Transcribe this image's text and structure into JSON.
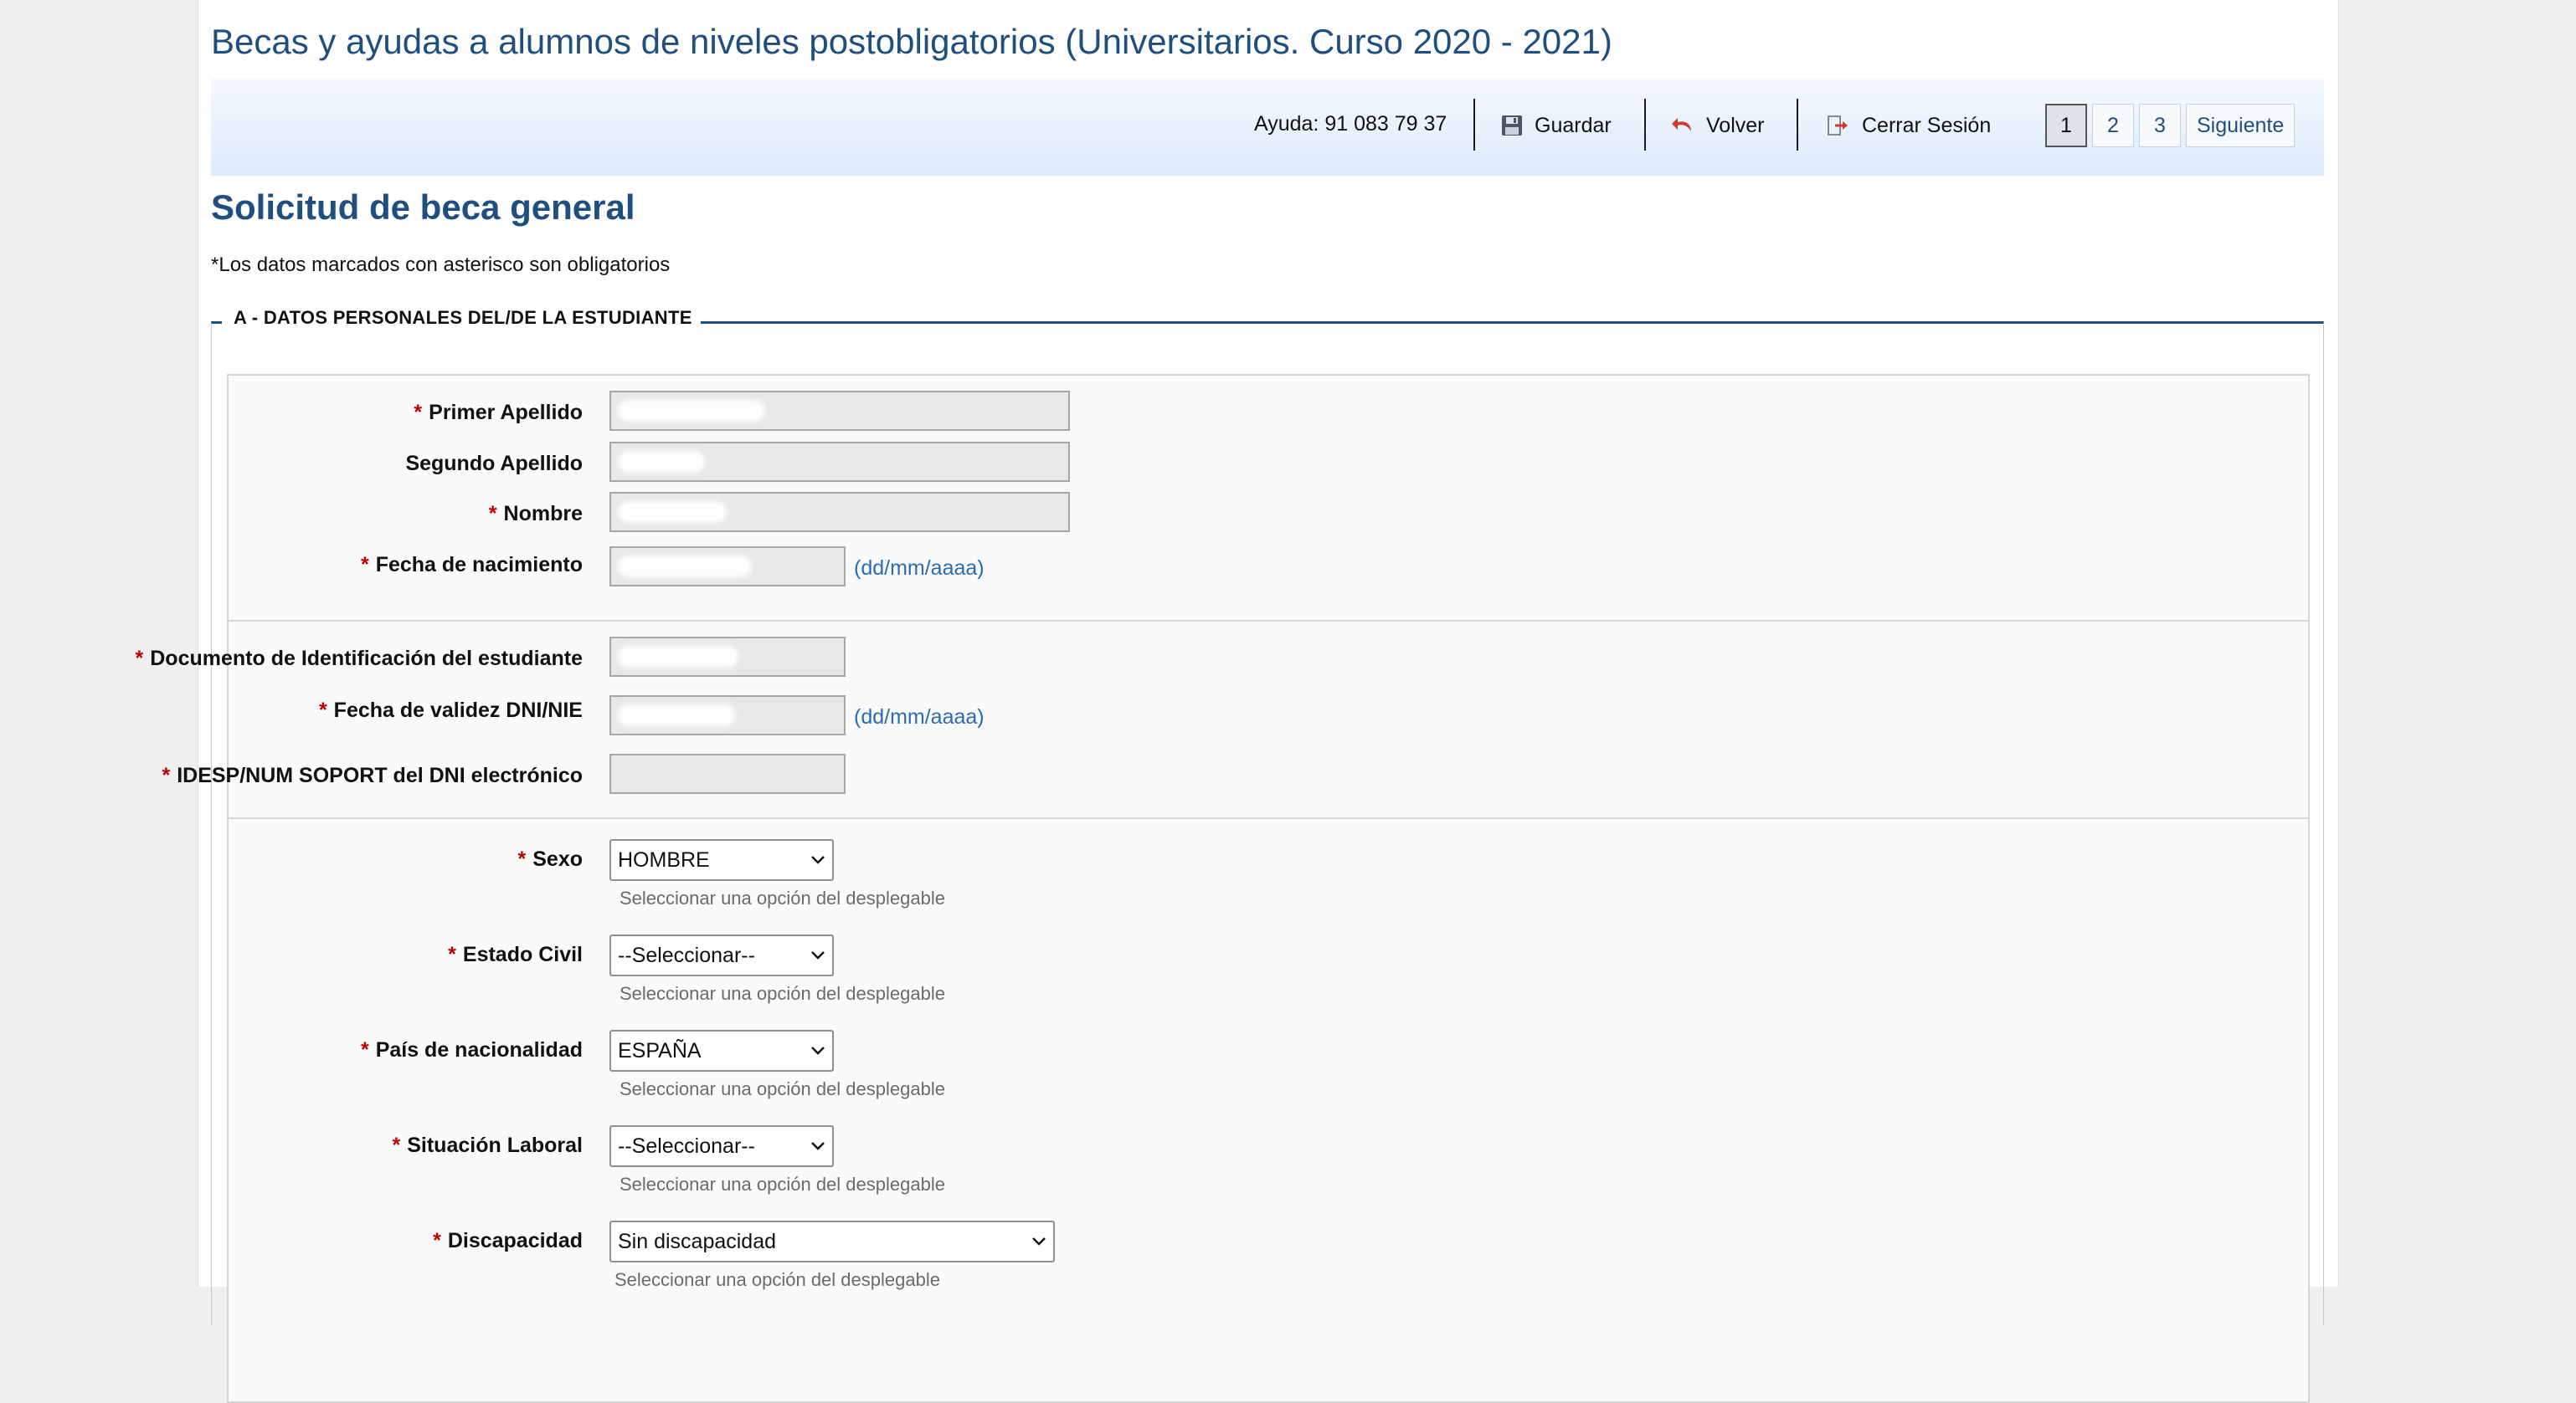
{
  "header": {
    "title": "Becas y ayudas a alumnos de niveles postobligatorios (Universitarios. Curso 2020 - 2021)"
  },
  "toolbar": {
    "help": "Ayuda: 91 083 79 37",
    "save_label": "Guardar",
    "back_label": "Volver",
    "logout_label": "Cerrar Sesión",
    "pages": [
      "1",
      "2",
      "3"
    ],
    "current_page": "1",
    "next_label": "Siguiente"
  },
  "main": {
    "subtitle": "Solicitud de beca general",
    "required_note": "*Los datos marcados con asterisco son obligatorios",
    "section_legend": "A - DATOS PERSONALES DEL/DE LA ESTUDIANTE",
    "required_mark": "*",
    "date_format_hint": "(dd/mm/aaaa)",
    "select_hint": "Seleccionar una opción del desplegable",
    "fields": {
      "primer_apellido": {
        "label": "Primer Apellido"
      },
      "segundo_apellido": {
        "label": "Segundo Apellido"
      },
      "nombre": {
        "label": "Nombre"
      },
      "fecha_nacimiento": {
        "label": "Fecha de nacimiento"
      },
      "documento": {
        "label": "Documento de Identificación del estudiante"
      },
      "fecha_validez": {
        "label": "Fecha de validez DNI/NIE"
      },
      "idesp": {
        "label": "IDESP/NUM SOPORT del DNI electrónico",
        "value": ""
      },
      "sexo": {
        "label": "Sexo",
        "value": "HOMBRE"
      },
      "estado_civil": {
        "label": "Estado Civil",
        "value": "--Seleccionar--"
      },
      "pais": {
        "label": "País de nacionalidad",
        "value": "ESPAÑA"
      },
      "situacion_laboral": {
        "label": "Situación Laboral",
        "value": "--Seleccionar--"
      },
      "discapacidad": {
        "label": "Discapacidad",
        "value": "Sin discapacidad"
      }
    }
  },
  "icons": {
    "save": "floppy-disk-icon",
    "back": "undo-arrow-icon",
    "logout": "logout-door-icon",
    "dropdown": "chevron-down-icon"
  },
  "colors": {
    "brand": "#1e4f7e",
    "required": "#c00000",
    "link_hint": "#2b6bb0"
  }
}
